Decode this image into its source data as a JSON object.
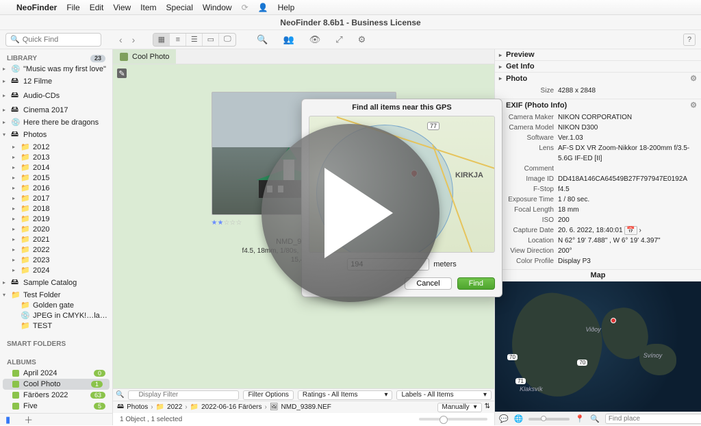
{
  "menubar": {
    "items": [
      "NeoFinder",
      "File",
      "Edit",
      "View",
      "Item",
      "Special",
      "Window",
      "Help"
    ]
  },
  "window": {
    "title": "NeoFinder 8.6b1 - Business License"
  },
  "toolbar": {
    "search_placeholder": "Quick Find"
  },
  "sidebar": {
    "library_label": "LIBRARY",
    "library_badge": "23",
    "items": [
      {
        "label": "\"Music was my first love\"",
        "icon": "💿",
        "chev": "▸",
        "ind": 0
      },
      {
        "label": "12 Filme",
        "icon": "🖴",
        "chev": "▸",
        "ind": 0
      },
      {
        "label": "Audio-CDs",
        "icon": "🖴",
        "chev": "▸",
        "ind": 0
      },
      {
        "label": "Cinema 2017",
        "icon": "🖴",
        "chev": "▸",
        "ind": 0
      },
      {
        "label": "Here there be dragons",
        "icon": "💿",
        "chev": "▸",
        "ind": 0
      },
      {
        "label": "Photos",
        "icon": "🖴",
        "chev": "▾",
        "ind": 0
      },
      {
        "label": "2012",
        "icon": "📁",
        "chev": "▸",
        "ind": 1
      },
      {
        "label": "2013",
        "icon": "📁",
        "chev": "▸",
        "ind": 1
      },
      {
        "label": "2014",
        "icon": "📁",
        "chev": "▸",
        "ind": 1
      },
      {
        "label": "2015",
        "icon": "📁",
        "chev": "▸",
        "ind": 1
      },
      {
        "label": "2016",
        "icon": "📁",
        "chev": "▸",
        "ind": 1
      },
      {
        "label": "2017",
        "icon": "📁",
        "chev": "▸",
        "ind": 1
      },
      {
        "label": "2018",
        "icon": "📁",
        "chev": "▸",
        "ind": 1
      },
      {
        "label": "2019",
        "icon": "📁",
        "chev": "▸",
        "ind": 1
      },
      {
        "label": "2020",
        "icon": "📁",
        "chev": "▸",
        "ind": 1
      },
      {
        "label": "2021",
        "icon": "📁",
        "chev": "▸",
        "ind": 1
      },
      {
        "label": "2022",
        "icon": "📁",
        "chev": "▸",
        "ind": 1
      },
      {
        "label": "2023",
        "icon": "📁",
        "chev": "▸",
        "ind": 1
      },
      {
        "label": "2024",
        "icon": "📁",
        "chev": "▸",
        "ind": 1
      },
      {
        "label": "Sample Catalog",
        "icon": "🖴",
        "chev": "▸",
        "ind": 0
      },
      {
        "label": "Test Folder",
        "icon": "📁",
        "chev": "▾",
        "ind": 0
      },
      {
        "label": "Golden gate",
        "icon": "📁",
        "chev": "",
        "ind": 1
      },
      {
        "label": "JPEG in CMYK!…lay@mac.com)",
        "icon": "💿",
        "chev": "",
        "ind": 1
      },
      {
        "label": "TEST",
        "icon": "📁",
        "chev": "",
        "ind": 1
      }
    ],
    "smart_label": "SMART FOLDERS",
    "albums_label": "ALBUMS",
    "albums": [
      {
        "name": "April 2024",
        "count": "0"
      },
      {
        "name": "Cool Photo",
        "count": "1",
        "selected": true
      },
      {
        "name": "Färöers 2022",
        "count": "63"
      },
      {
        "name": "Five",
        "count": "5"
      }
    ]
  },
  "tabs": {
    "active_label": "Cool Photo"
  },
  "photo": {
    "filename": "NMD_9389.NEF",
    "meta": "f4.5, 18mm, 1/80s, ISO200, 4288 x 2848",
    "size": "15,4 MB"
  },
  "filters": {
    "display_placeholder": "Display Filter",
    "options_label": "Filter Options",
    "ratings_label": "Ratings - All Items",
    "labels_label": "Labels - All Items"
  },
  "crumbs": {
    "parts": [
      "Photos",
      "2022",
      "2022-06-16 Färöers",
      "NMD_9389.NEF"
    ],
    "manual": "Manually"
  },
  "status": {
    "text": "1 Object  ,  1 selected"
  },
  "inspector": {
    "sections": {
      "preview": "Preview",
      "get_info": "Get Info",
      "photo": "Photo",
      "exif": "EXIF (Photo Info)"
    },
    "size_label": "Size",
    "size_value": "4288 x 2848",
    "exif": [
      {
        "k": "Camera Maker",
        "v": "NIKON CORPORATION"
      },
      {
        "k": "Camera Model",
        "v": "NIKON D300"
      },
      {
        "k": "Software",
        "v": "Ver.1.03"
      },
      {
        "k": "Lens",
        "v": "AF-S DX VR Zoom-Nikkor 18-200mm f/3.5-5.6G IF-ED [II]"
      },
      {
        "k": "Comment",
        "v": ""
      },
      {
        "k": "Image ID",
        "v": "DD418A146CA64549B27F797947E0192A"
      },
      {
        "k": "F-Stop",
        "v": "f4.5"
      },
      {
        "k": "Exposure Time",
        "v": "1 / 80 sec."
      },
      {
        "k": "Focal Length",
        "v": "18 mm"
      },
      {
        "k": "ISO",
        "v": "200"
      },
      {
        "k": "Capture Date",
        "v": "20. 6. 2022,  18:40:01"
      },
      {
        "k": "Location",
        "v": "N 62° 19' 7.488\" , W 6° 19' 4.397\""
      },
      {
        "k": "View Direction",
        "v": "200°"
      },
      {
        "k": "Color Profile",
        "v": "Display P3"
      }
    ],
    "map_label": "Map",
    "map_places": [
      "Viðoy",
      "Svínoy",
      "Klaksvík"
    ],
    "find_place_placeholder": "Find place"
  },
  "modal": {
    "title": "Find all items near this GPS",
    "route": "77",
    "place": "KIRKJA",
    "radius_value": "194",
    "radius_unit": "meters",
    "cancel": "Cancel",
    "find": "Find"
  }
}
